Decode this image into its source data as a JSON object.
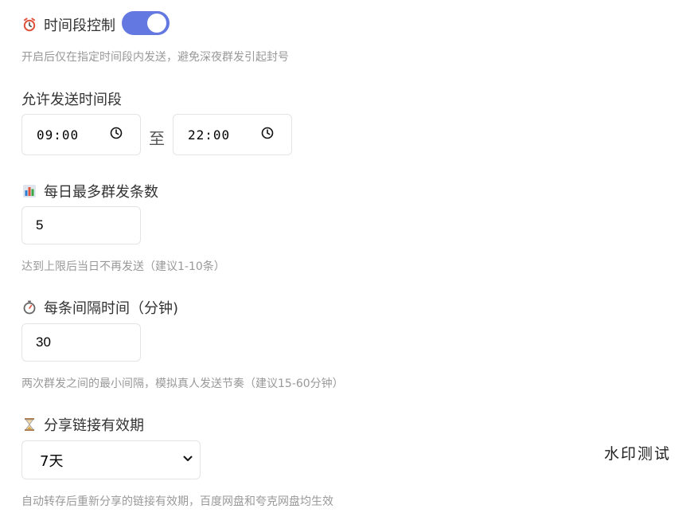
{
  "schedule": {
    "icon": "alarm-clock-icon",
    "title": "时间段控制",
    "toggle_on": true,
    "hint": "开启后仅在指定时间段内发送，避免深夜群发引起封号"
  },
  "time_range": {
    "title": "允许发送时间段",
    "start": "09:00",
    "separator": "至",
    "end": "22:00"
  },
  "daily_limit": {
    "icon": "bar-chart-icon",
    "title": "每日最多群发条数",
    "value": "5",
    "hint": "达到上限后当日不再发送（建议1-10条）"
  },
  "interval": {
    "icon": "stopwatch-icon",
    "title": "每条间隔时间（分钟)",
    "value": "30",
    "hint": "两次群发之间的最小间隔，模拟真人发送节奏（建议15-60分钟）"
  },
  "share_link": {
    "icon": "hourglass-icon",
    "title": "分享链接有效期",
    "selected": "7天",
    "hint": "自动转存后重新分享的链接有效期，百度网盘和夸克网盘均生效"
  },
  "watermark": "水印测试",
  "colors": {
    "toggle": "#6378e0",
    "hint": "#999999",
    "border": "#e4e4e4"
  }
}
